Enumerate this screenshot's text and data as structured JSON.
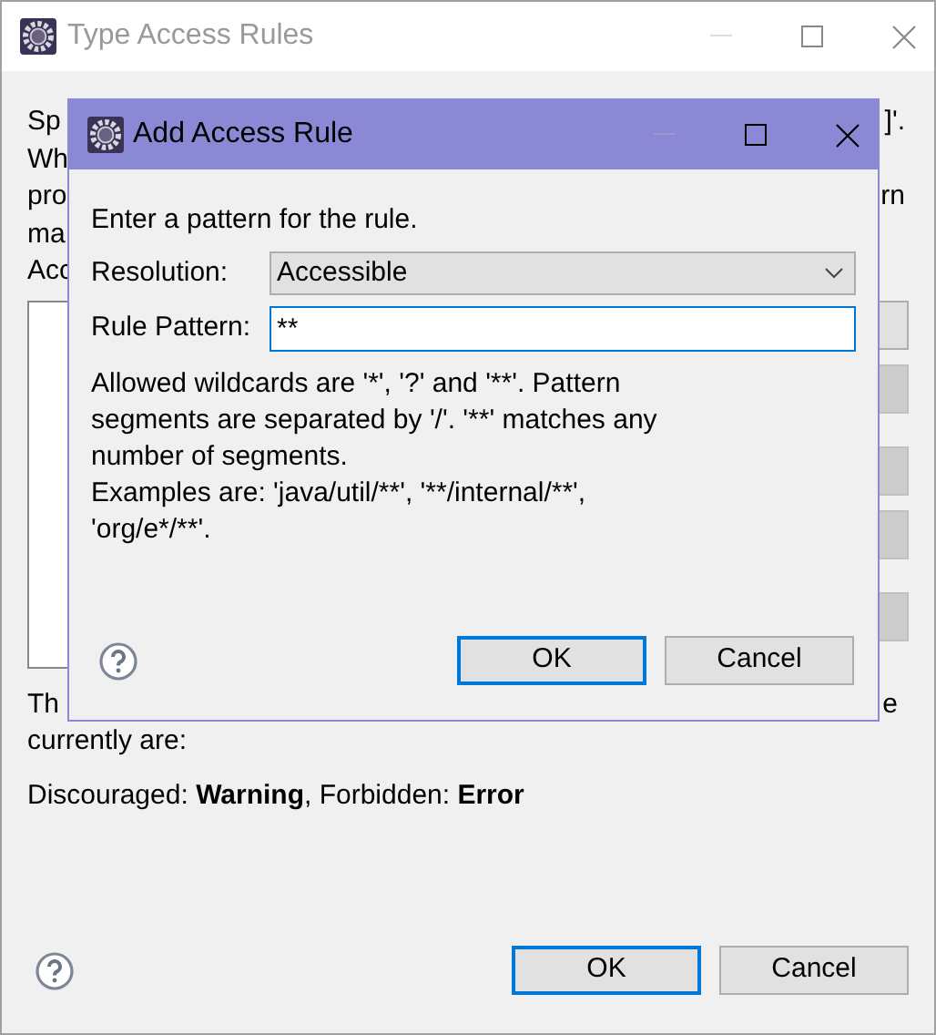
{
  "window": {
    "title": "Type Access Rules",
    "active": false
  },
  "intro_fragments": [
    {
      "left": "Sp",
      "right": "]'."
    },
    {
      "left": "Wh"
    },
    {
      "left": "pro",
      "right": "rn"
    },
    {
      "left": "ma"
    },
    {
      "left": "Acc"
    }
  ],
  "side_buttons": [
    {
      "disabled": false
    },
    {
      "disabled": true
    },
    {
      "disabled": true
    },
    {
      "disabled": true
    },
    {
      "disabled": true
    }
  ],
  "note_fragments": {
    "left": "Th",
    "right": "e"
  },
  "note_end": "currently are:",
  "severity": "Discouraged: **Warning**, Forbidden: **Error**",
  "buttons": [
    {
      "label": "OK",
      "default": true
    },
    {
      "label": "Cancel",
      "default": false
    }
  ],
  "dialog": {
    "title": "Add Access Rule",
    "active": true,
    "prompt": "Enter a pattern for the rule.",
    "resolution": {
      "label": "Resolution:",
      "value": "Accessible"
    },
    "rule_pattern": {
      "label": "Rule Pattern:",
      "value": "**",
      "focused": true
    },
    "help_text": [
      "Allowed wildcards are '*', '?' and '**'. Pattern segments are separated by '/'. '**' matches any number of segments.",
      "Examples are: 'java/util/**', '**/internal/**', 'org/e*/**'."
    ],
    "buttons": [
      {
        "label": "OK",
        "default": true
      },
      {
        "label": "Cancel",
        "default": false
      }
    ]
  }
}
